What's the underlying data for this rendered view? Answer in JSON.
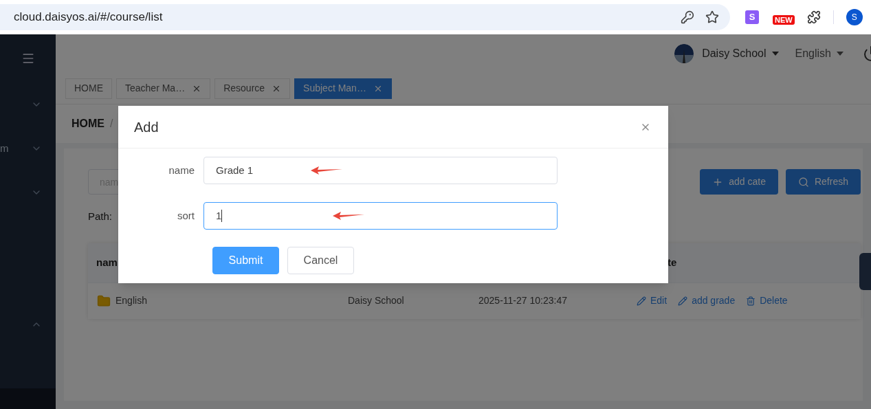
{
  "browser": {
    "url": "cloud.daisyos.ai/#/course/list",
    "extension_letter": "S",
    "new_badge": "NEW",
    "profile_initial": "S"
  },
  "header": {
    "school": "Daisy School",
    "language": "English"
  },
  "sidebar": {
    "items": [
      {
        "expanded": false
      },
      {
        "label": "m",
        "expanded": false
      },
      {
        "expanded": false
      },
      {
        "expanded": true
      }
    ]
  },
  "tabs": [
    {
      "label": "HOME",
      "selected": false,
      "closable": false
    },
    {
      "label": "Teacher Ma…",
      "selected": false,
      "closable": true
    },
    {
      "label": "Resource",
      "selected": false,
      "closable": true
    },
    {
      "label": "Subject Man…",
      "selected": true,
      "closable": true
    }
  ],
  "breadcrumb": [
    "HOME",
    "/"
  ],
  "toolbar": {
    "search_placeholder": "nam",
    "buttons": [
      {
        "label": "add cate",
        "kind": "add"
      },
      {
        "label": "Refresh",
        "kind": "refresh"
      }
    ]
  },
  "path_label": "Path:",
  "table": {
    "columns": [
      "nam",
      "te"
    ],
    "rows": [
      {
        "name": "English",
        "school": "Daisy School",
        "time": "2025-11-27 10:23:47",
        "actions": [
          {
            "label": "Edit",
            "kind": "edit"
          },
          {
            "label": "add grade",
            "kind": "edit"
          },
          {
            "label": "Delete",
            "kind": "delete"
          }
        ]
      }
    ]
  },
  "dialog": {
    "title": "Add",
    "fields": [
      {
        "label": "name",
        "value": "Grade 1",
        "focused": false,
        "annotated": true
      },
      {
        "label": "sort",
        "value": "1",
        "focused": true,
        "annotated": true
      }
    ],
    "buttons": [
      {
        "label": "Submit",
        "kind": "primary"
      },
      {
        "label": "Cancel",
        "kind": "default"
      }
    ]
  }
}
